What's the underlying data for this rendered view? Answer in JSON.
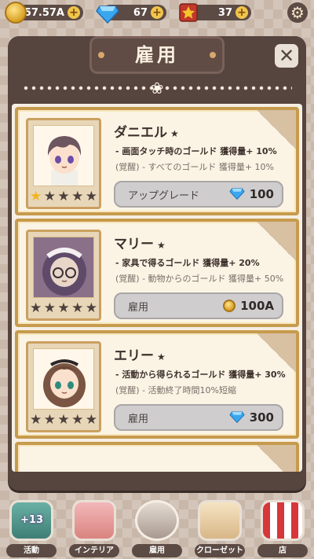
{
  "topbar": {
    "gold": "57.57A",
    "gems": "67",
    "tickets": "37",
    "plus": "+"
  },
  "panel": {
    "title": "雇用",
    "close_label": "✕"
  },
  "employees": [
    {
      "name": "ダニエル",
      "stars": 1,
      "perk": "- 画面タッチ時のゴールド 獲得量+ 10%",
      "awaken": "(覚醒) - すべてのゴールド 獲得量+ 10%",
      "action": "アップグレード",
      "cost": "100",
      "currency": "gem"
    },
    {
      "name": "マリー",
      "stars": 0,
      "perk": "- 家具で得るゴールド 獲得量+ 20%",
      "awaken": "(覚醒) - 動物からのゴールド 獲得量+ 50%",
      "action": "雇用",
      "cost": "100A",
      "currency": "gold"
    },
    {
      "name": "エリー",
      "stars": 0,
      "perk": "- 活動から得られるゴールド 獲得量+ 30%",
      "awaken": "(覚醒) - 活動終了時間10%短縮",
      "action": "雇用",
      "cost": "300",
      "currency": "gem"
    }
  ],
  "bottom_nav": [
    {
      "label": "活動",
      "badge": "+13"
    },
    {
      "label": "インテリア"
    },
    {
      "label": "雇用"
    },
    {
      "label": "クローゼット"
    },
    {
      "label": "店"
    }
  ],
  "colors": {
    "panel": "#56443f",
    "card_border": "#c79b4d",
    "button": "#cfcdcd",
    "star_on": "#f1b51d"
  }
}
